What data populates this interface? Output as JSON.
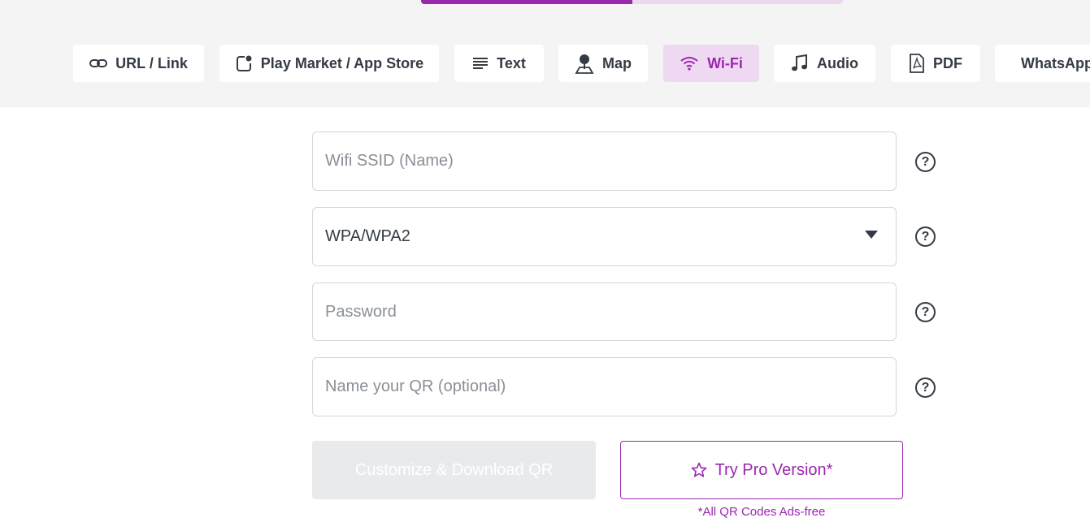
{
  "progress": {
    "fraction": 0.5
  },
  "tabs": [
    {
      "label": "URL / Link",
      "icon": "link-icon"
    },
    {
      "label": "Play Market / App Store",
      "icon": "app-store-icon"
    },
    {
      "label": "Text",
      "icon": "text-lines-icon"
    },
    {
      "label": "Map",
      "icon": "map-pin-icon"
    },
    {
      "label": "Wi-Fi",
      "icon": "wifi-icon",
      "active": true
    },
    {
      "label": "Audio",
      "icon": "music-note-icon"
    },
    {
      "label": "PDF",
      "icon": "pdf-icon"
    },
    {
      "label": "WhatsApp",
      "icon": "whatsapp-icon"
    }
  ],
  "form": {
    "ssid_placeholder": "Wifi SSID (Name)",
    "security_value": "WPA/WPA2",
    "password_placeholder": "Password",
    "qr_name_placeholder": "Name your QR (optional)",
    "help_glyph": "?"
  },
  "actions": {
    "customize_label": "Customize & Download QR",
    "pro_label": "Try Pro Version*",
    "pro_note": "*All QR Codes Ads-free"
  },
  "colors": {
    "accent": "#9b27af",
    "accent_soft": "#efd8f1",
    "text": "#353b44"
  }
}
